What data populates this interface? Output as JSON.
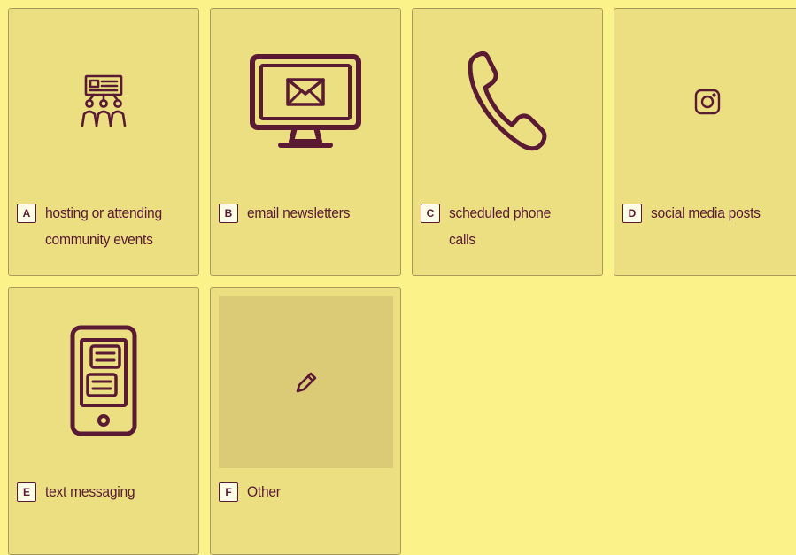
{
  "colors": {
    "page_background": "#FBF38A",
    "card_background": "#EBDF82",
    "card_border": "#A89A5C",
    "accent": "#5A1A33",
    "key_background": "#FFFCE8",
    "other_area": "#DCCB76"
  },
  "options": [
    {
      "key": "A",
      "label": "hosting or attending community events",
      "icon": "community-event-icon"
    },
    {
      "key": "B",
      "label": "email newsletters",
      "icon": "email-monitor-icon"
    },
    {
      "key": "C",
      "label": "scheduled phone calls",
      "icon": "phone-icon"
    },
    {
      "key": "D",
      "label": "social media posts",
      "icon": "instagram-icon"
    },
    {
      "key": "E",
      "label": "text messaging",
      "icon": "text-message-phone-icon"
    },
    {
      "key": "F",
      "label": "Other",
      "icon": "pencil-icon"
    }
  ]
}
